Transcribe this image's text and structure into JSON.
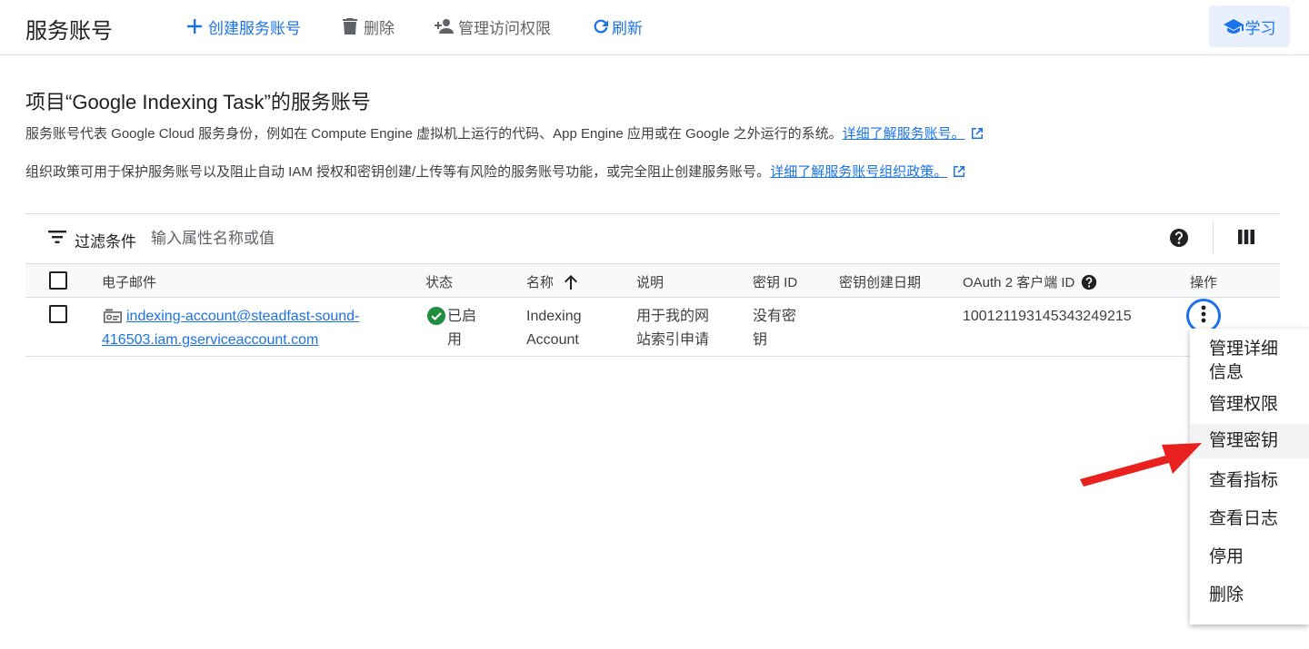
{
  "toolbar": {
    "title": "服务账号",
    "create_label": "创建服务账号",
    "delete_label": "删除",
    "manage_access_label": "管理访问权限",
    "refresh_label": "刷新",
    "learn_label": "学习"
  },
  "header": {
    "title": "项目“Google Indexing Task”的服务账号",
    "desc1": "服务账号代表 Google Cloud 服务身份，例如在 Compute Engine 虚拟机上运行的代码、App Engine 应用或在 Google 之外运行的系统。",
    "desc1_link": "详细了解服务账号。",
    "desc2": "组织政策可用于保护服务账号以及阻止自动 IAM 授权和密钥创建/上传等有风险的服务账号功能，或完全阻止创建服务账号。",
    "desc2_link": "详细了解服务账号组织政策。"
  },
  "filter": {
    "label": "过滤条件",
    "placeholder": "输入属性名称或值"
  },
  "table": {
    "columns": {
      "email": "电子邮件",
      "status": "状态",
      "name": "名称",
      "description": "说明",
      "key_id": "密钥 ID",
      "key_date": "密钥创建日期",
      "oauth": "OAuth 2 客户端 ID",
      "actions": "操作"
    },
    "rows": [
      {
        "email_line1": "indexing-account@steadfast-sound-",
        "email_line2": "416503.iam.gserviceaccount.com",
        "status_line1": "已启",
        "status_line2": "用",
        "name_line1": "Indexing",
        "name_line2": "Account",
        "desc_line1": "用于我的网",
        "desc_line2": "站索引申请",
        "key_line1": "没有密",
        "key_line2": "钥",
        "key_date": "",
        "oauth_id": "100121193145343249215"
      }
    ]
  },
  "menu": {
    "items": [
      {
        "label_line1": "管理详细",
        "label_line2": "信息"
      },
      {
        "label": "管理权限"
      },
      {
        "label": "管理密钥"
      },
      {
        "label": "查看指标"
      },
      {
        "label": "查看日志"
      },
      {
        "label": "停用"
      },
      {
        "label": "删除"
      }
    ]
  },
  "colors": {
    "accent": "#1a73e8",
    "status_ok": "#1e8e3e",
    "arrow": "#e8201e"
  }
}
